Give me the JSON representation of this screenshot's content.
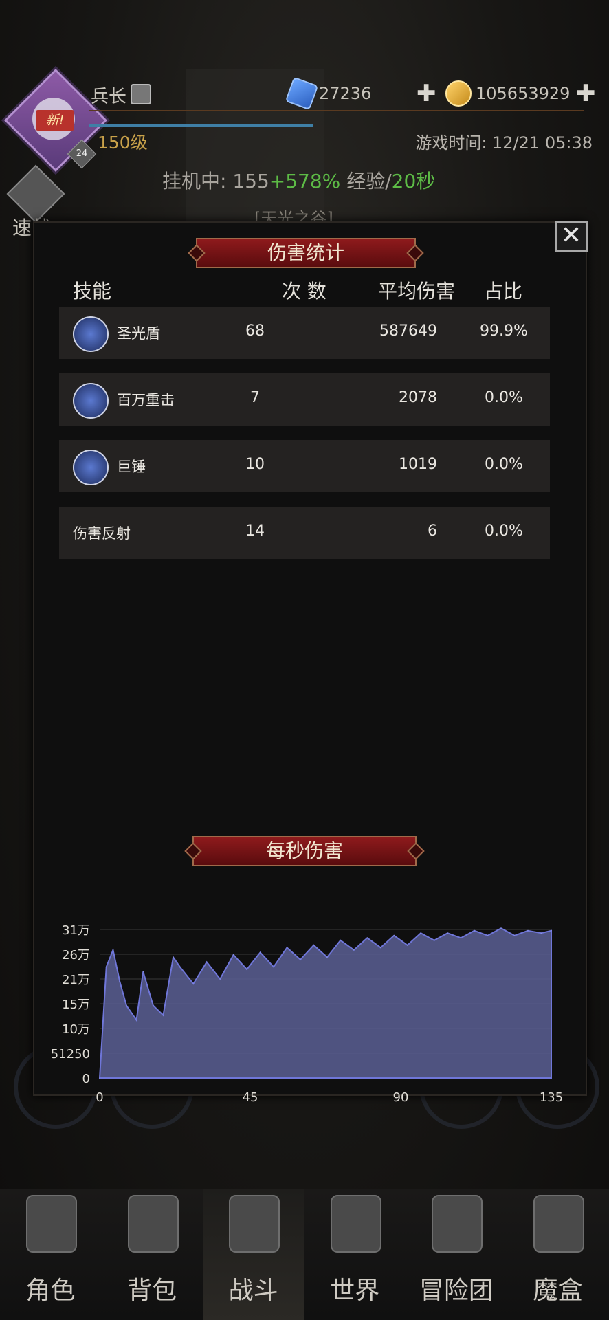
{
  "hud": {
    "player_name": "兵长",
    "new_badge": "新!",
    "avatar_level": "24",
    "level_text": "150级",
    "gems": "27236",
    "gold": "105653929",
    "game_time": "游戏时间: 12/21 05:38",
    "idle_prefix": "挂机中: 155",
    "idle_bonus": "+578%",
    "idle_mid": " 经验/",
    "idle_rate": "20秒",
    "speed_label": "速战",
    "zone_label": "[天光之谷]",
    "exp_fraction": 0.59
  },
  "panel": {
    "close_label": "✕",
    "title": "伤害统计",
    "headers": {
      "skill": "技能",
      "count": "次 数",
      "avg": "平均伤害",
      "pct": "占比"
    },
    "rows": [
      {
        "name": "圣光盾",
        "count": "68",
        "avg": "587649",
        "pct": "99.9%",
        "icon": "shield-icon"
      },
      {
        "name": "百万重击",
        "count": "7",
        "avg": "2078",
        "pct": "0.0%",
        "icon": "explosion-icon"
      },
      {
        "name": "巨锤",
        "count": "10",
        "avg": "1019",
        "pct": "0.0%",
        "icon": "sword-icon"
      },
      {
        "name": "伤害反射",
        "count": "14",
        "avg": "6",
        "pct": "0.0%",
        "icon": ""
      }
    ],
    "dps_title": "每秒伤害"
  },
  "chart_data": {
    "type": "area",
    "title": "每秒伤害",
    "x_ticks": [
      "0",
      "45",
      "90",
      "135"
    ],
    "y_ticks": [
      "0",
      "51250",
      "10万",
      "15万",
      "21万",
      "26万",
      "31万"
    ],
    "xlim": [
      0,
      135
    ],
    "ylim": [
      0,
      307500
    ],
    "x": [
      0,
      2,
      4,
      6,
      8,
      11,
      13,
      16,
      19,
      22,
      24,
      28,
      32,
      36,
      40,
      44,
      48,
      52,
      56,
      60,
      64,
      68,
      72,
      76,
      80,
      84,
      88,
      92,
      96,
      100,
      104,
      108,
      112,
      116,
      120,
      124,
      128,
      132,
      135
    ],
    "y": [
      0,
      230000,
      265000,
      200000,
      150000,
      120000,
      220000,
      150000,
      130000,
      250000,
      230000,
      195000,
      240000,
      205000,
      255000,
      225000,
      260000,
      230000,
      270000,
      245000,
      275000,
      250000,
      285000,
      265000,
      290000,
      270000,
      295000,
      275000,
      300000,
      285000,
      300000,
      290000,
      305000,
      295000,
      310000,
      295000,
      305000,
      300000,
      305000
    ],
    "grid": true,
    "color": "#5a5f94"
  },
  "nav": {
    "items": [
      {
        "label": "角色",
        "icon": "helmet-icon"
      },
      {
        "label": "背包",
        "icon": "backpack-icon"
      },
      {
        "label": "战斗",
        "icon": "shield-sword-icon"
      },
      {
        "label": "世界",
        "icon": "map-icon"
      },
      {
        "label": "冒险团",
        "icon": "castle-icon"
      },
      {
        "label": "魔盒",
        "icon": "cube-icon"
      }
    ],
    "active": 2
  }
}
